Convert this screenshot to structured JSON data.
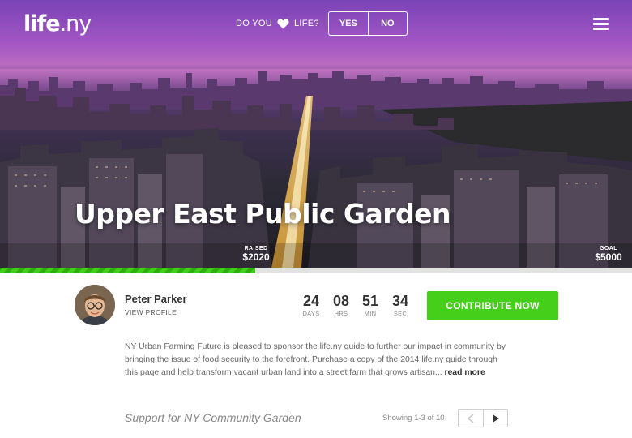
{
  "brand": {
    "logo_main": "life",
    "logo_tld": ".ny"
  },
  "love_bar": {
    "prefix": "DO YOU",
    "suffix": "LIFE?",
    "yes": "YES",
    "no": "NO"
  },
  "hero": {
    "title": "Upper East Public Garden"
  },
  "funding": {
    "raised_label": "RAISED",
    "raised_value": "$2020",
    "goal_label": "GOAL",
    "goal_value": "$5000",
    "progress_fraction": 0.404
  },
  "profile": {
    "name": "Peter Parker",
    "link": "VIEW PROFILE"
  },
  "countdown": [
    {
      "value": "24",
      "label": "DAYS"
    },
    {
      "value": "08",
      "label": "HRS"
    },
    {
      "value": "51",
      "label": "MIN"
    },
    {
      "value": "34",
      "label": "SEC"
    }
  ],
  "cta": {
    "label": "CONTRIBUTE NOW"
  },
  "description": {
    "text": "NY Urban Farming Future is pleased to sponsor the life.ny guide to further our impact in community by bringing the issue of food security to the forefront. Purchase a copy of the 2014 life.ny guide through this page and help transform vacant urban land into a street farm that grows artisan...",
    "read_more": "read more"
  },
  "support": {
    "title": "Support for NY Community Garden",
    "showing": "Showing 1-3 of 10"
  },
  "colors": {
    "accent_green": "#45ce1a",
    "hero_purple": "#a356c4"
  },
  "icons": {
    "love": "heart-icon",
    "menu": "hamburger-menu-icon",
    "prev": "chevron-left-icon",
    "next": "chevron-right-icon"
  }
}
